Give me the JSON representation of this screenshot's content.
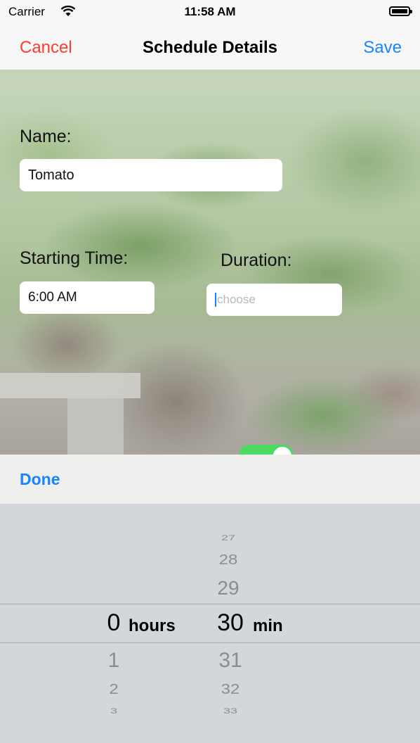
{
  "status_bar": {
    "carrier": "Carrier",
    "time": "11:58 AM",
    "wifi_icon": "wifi-icon",
    "battery_icon": "battery-icon"
  },
  "nav": {
    "cancel_label": "Cancel",
    "title": "Schedule Details",
    "save_label": "Save",
    "cancel_color": "#ff3b30",
    "save_color": "#1a84ff"
  },
  "form": {
    "name_label": "Name:",
    "name_value": "Tomato",
    "start_label": "Starting Time:",
    "start_value": "6:00 AM",
    "duration_label": "Duration:",
    "duration_placeholder": "choose",
    "repeat_toggle_on": true
  },
  "toolbar": {
    "done_label": "Done"
  },
  "picker": {
    "hours": {
      "selected": "0",
      "unit": "hours",
      "below": [
        "1",
        "2",
        "3"
      ]
    },
    "minutes": {
      "above": [
        "27",
        "28",
        "29"
      ],
      "selected": "30",
      "unit": "min",
      "below": [
        "31",
        "32",
        "33"
      ]
    }
  },
  "colors": {
    "accent": "#1a84ff",
    "destructive": "#ff3b30",
    "toggle_on": "#4cd964",
    "picker_bg": "#d3d6da"
  }
}
